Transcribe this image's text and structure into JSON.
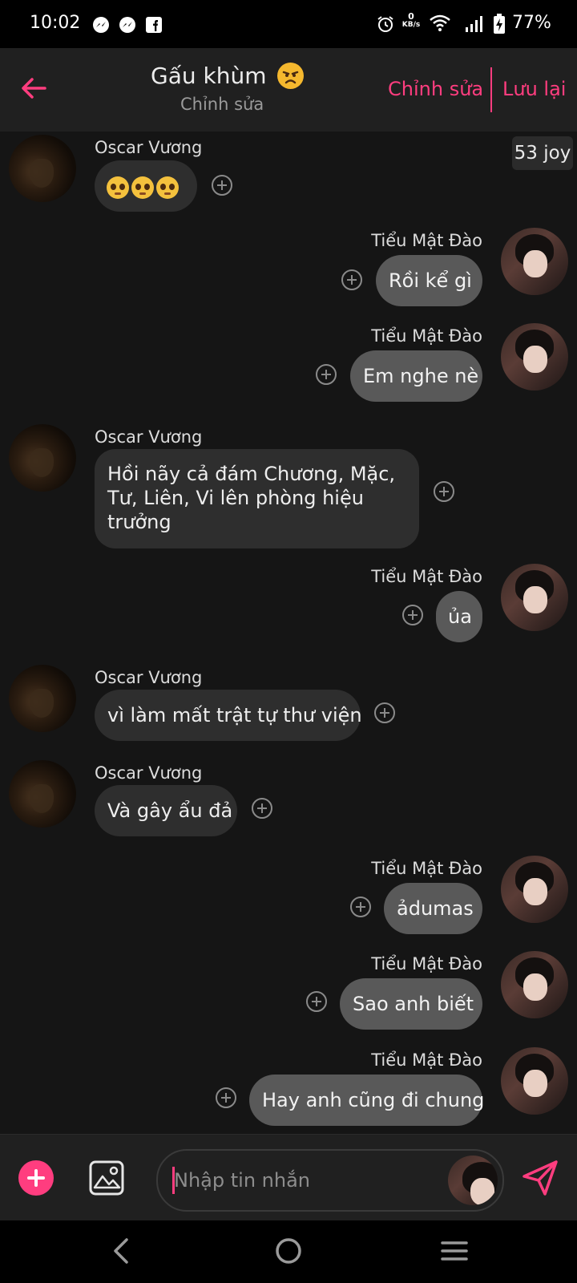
{
  "status_bar": {
    "time": "10:02",
    "battery": "77%",
    "net_speed_value": "0",
    "net_speed_unit": "KB/s"
  },
  "header": {
    "title": "Gấu khùm",
    "subtitle": "Chỉnh sửa",
    "edit_label": "Chỉnh sửa",
    "save_label": "Lưu lại"
  },
  "reaction_badge": "53 joy",
  "messages": [
    {
      "sender": "Oscar Vương",
      "side": "left",
      "text": "🥺🥺🥺"
    },
    {
      "sender": "Tiểu Mật Đào",
      "side": "right",
      "text": "Rồi kể gì"
    },
    {
      "sender": "Tiểu Mật Đào",
      "side": "right",
      "text": "Em nghe nè"
    },
    {
      "sender": "Oscar Vương",
      "side": "left",
      "lines": [
        "Hồi nãy cả đám Chương, Mặc,",
        "Tư, Liên, Vi lên phòng hiệu",
        "trưởng"
      ]
    },
    {
      "sender": "Tiểu Mật Đào",
      "side": "right",
      "text": "ủa"
    },
    {
      "sender": "Oscar Vương",
      "side": "left",
      "text": "vì làm mất trật tự thư viện"
    },
    {
      "sender": "Oscar Vương",
      "side": "left",
      "text": "Và gây ẩu đả"
    },
    {
      "sender": "Tiểu Mật Đào",
      "side": "right",
      "text": "ảdumas"
    },
    {
      "sender": "Tiểu Mật Đào",
      "side": "right",
      "text": "Sao anh biết"
    },
    {
      "sender": "Tiểu Mật Đào",
      "side": "right",
      "text": "Hay anh cũng đi chung"
    }
  ],
  "composer": {
    "placeholder": "Nhập tin nhắn"
  },
  "colors": {
    "accent": "#ff3d7f",
    "incoming_bubble": "#2e2e2e",
    "outgoing_bubble": "#595959"
  },
  "icons": [
    "back-arrow-icon",
    "add-icon",
    "image-icon",
    "send-icon",
    "nav-back-icon",
    "nav-home-icon",
    "nav-recents-icon"
  ]
}
